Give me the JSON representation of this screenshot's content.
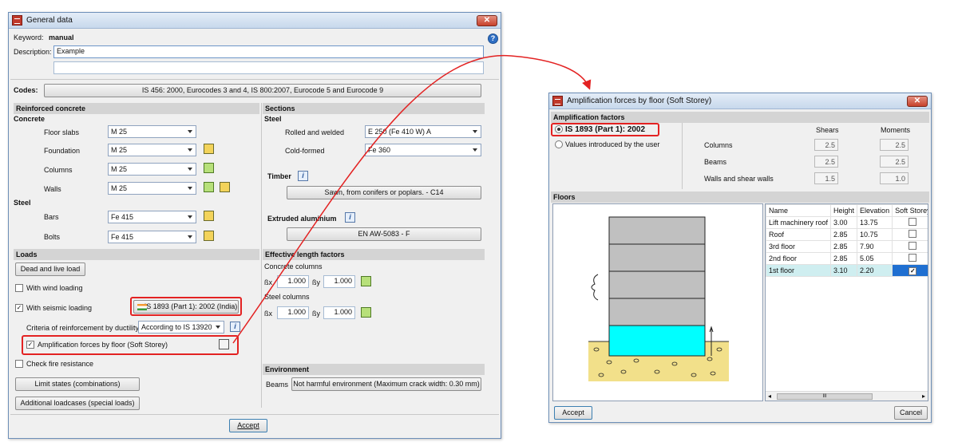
{
  "general": {
    "title": "General data",
    "keyword_label": "Keyword:",
    "keyword_value": "manual",
    "description_label": "Description:",
    "description_value": "Example",
    "description_line2": "",
    "codes_label": "Codes:",
    "codes_value": "IS 456: 2000, Eurocodes 3 and 4, IS 800:2007, Eurocode 5 and Eurocode 9",
    "reinforced_concrete": {
      "header": "Reinforced concrete",
      "concrete_label": "Concrete",
      "rows": [
        {
          "label": "Floor slabs",
          "value": "M 25"
        },
        {
          "label": "Foundation",
          "value": "M 25"
        },
        {
          "label": "Columns",
          "value": "M 25"
        },
        {
          "label": "Walls",
          "value": "M 25"
        }
      ],
      "steel_label": "Steel",
      "steel_rows": [
        {
          "label": "Bars",
          "value": "Fe 415"
        },
        {
          "label": "Bolts",
          "value": "Fe 415"
        }
      ]
    },
    "sections": {
      "header": "Sections",
      "steel_label": "Steel",
      "rolled_label": "Rolled and welded",
      "rolled_value": "E 250 (Fe 410 W) A",
      "cold_label": "Cold-formed",
      "cold_value": "Fe 360",
      "timber_label": "Timber",
      "timber_value": "Sawn, from conifers or poplars. - C14",
      "aluminium_label": "Extruded aluminium",
      "aluminium_value": "EN AW-5083 - F"
    },
    "loads": {
      "header": "Loads",
      "dead_live": "Dead and live load",
      "wind": "With wind loading",
      "seismic": "With seismic loading",
      "seismic_code": "IS 1893 (Part 1): 2002 (India)",
      "criteria_label": "Criteria of reinforcement by ductility",
      "criteria_value": "According to IS 13920",
      "amplification": "Amplification forces by floor (Soft Storey)",
      "fire": "Check fire resistance",
      "limit_states": "Limit states (combinations)",
      "additional": "Additional loadcases (special loads)"
    },
    "effective_length": {
      "header": "Effective length factors",
      "concrete_label": "Concrete columns",
      "steel_label": "Steel columns",
      "bx": "ßx",
      "by": "ßy",
      "concrete_bx": "1.000",
      "concrete_by": "1.000",
      "steel_bx": "1.000",
      "steel_by": "1.000"
    },
    "environment": {
      "header": "Environment",
      "beams_label": "Beams",
      "beams_value": "Not harmful environment (Maximum crack width: 0.30 mm)"
    },
    "accept": "Accept"
  },
  "amp": {
    "title": "Amplification forces by floor (Soft Storey)",
    "factors_header": "Amplification factors",
    "option1": "IS 1893 (Part 1): 2002",
    "option2": "Values introduced by the user",
    "shears_label": "Shears",
    "moments_label": "Moments",
    "rows": [
      {
        "label": "Columns",
        "shears": "2.5",
        "moments": "2.5"
      },
      {
        "label": "Beams",
        "shears": "2.5",
        "moments": "2.5"
      },
      {
        "label": "Walls and shear walls",
        "shears": "1.5",
        "moments": "1.0"
      }
    ],
    "floors_header": "Floors",
    "columns": [
      "Name",
      "Height",
      "Elevation",
      "Soft Storey"
    ],
    "floors": [
      {
        "name": "Lift machinery roof",
        "height": "3.00",
        "elevation": "13.75",
        "soft": false
      },
      {
        "name": "Roof",
        "height": "2.85",
        "elevation": "10.75",
        "soft": false
      },
      {
        "name": "3rd floor",
        "height": "2.85",
        "elevation": "7.90",
        "soft": false
      },
      {
        "name": "2nd floor",
        "height": "2.85",
        "elevation": "5.05",
        "soft": false
      },
      {
        "name": "1st floor",
        "height": "3.10",
        "elevation": "2.20",
        "soft": true
      }
    ],
    "scroll_glyph": "III",
    "accept": "Accept",
    "cancel": "Cancel"
  },
  "colors": {
    "highlight_red": "#e32222",
    "soft_storey_fill": "#00ffff",
    "floor_fill": "#c0c0c0",
    "soil_fill": "#f2e08a",
    "section_bg": "#d4d4d4"
  }
}
